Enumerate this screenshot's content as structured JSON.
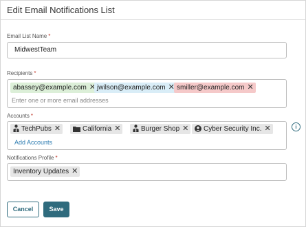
{
  "dialog": {
    "title": "Edit Email Notifications List"
  },
  "email_list_name": {
    "label": "Email List Name",
    "required_mark": "*",
    "value": "MidwestTeam"
  },
  "recipients": {
    "label": "Recipients",
    "required_mark": "*",
    "chips": [
      {
        "text": "abassey@example.com",
        "color": "#dcefd8"
      },
      {
        "text": "jwilson@example.com",
        "color": "#d9edf7"
      },
      {
        "text": "smiller@example.com",
        "color": "#f5c9c9"
      }
    ],
    "placeholder": "Enter one or more email addresses"
  },
  "accounts": {
    "label": "Accounts",
    "required_mark": "*",
    "chips": [
      {
        "text": "TechPubs",
        "icon": "person-tie-icon"
      },
      {
        "text": "California",
        "icon": "folder-icon"
      },
      {
        "text": "Burger Shop",
        "icon": "person-tie-icon"
      },
      {
        "text": "Cyber Security Inc.",
        "icon": "user-circle-icon"
      }
    ],
    "add_link": "Add Accounts",
    "info_icon": "i"
  },
  "notifications_profile": {
    "label": "Notifications Profile",
    "required_mark": "*",
    "chips": [
      {
        "text": "Inventory Updates"
      }
    ]
  },
  "buttons": {
    "cancel": "Cancel",
    "save": "Save"
  },
  "chip_close_glyph": "✕",
  "colors": {
    "accent": "#2f6b7d",
    "link": "#2a7ab0",
    "required": "#c0392b"
  }
}
